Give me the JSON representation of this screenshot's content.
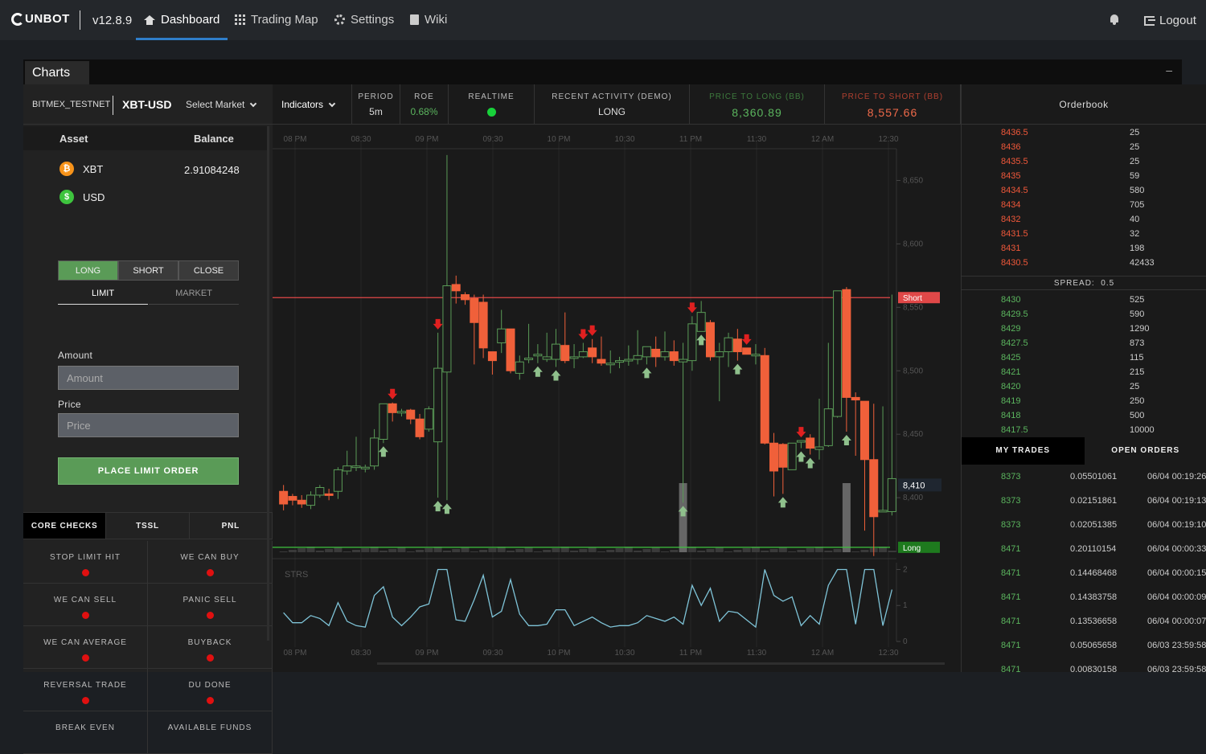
{
  "nav": {
    "brand": "UNBOT",
    "version": "v12.8.9",
    "items": [
      {
        "label": "Dashboard",
        "active": true
      },
      {
        "label": "Trading Map"
      },
      {
        "label": "Settings"
      },
      {
        "label": "Wiki"
      }
    ],
    "logout": "Logout"
  },
  "panel": {
    "title": "Charts",
    "minimize": "–"
  },
  "market": {
    "exchange": "BITMEX_TESTNET",
    "pair": "XBT-USD",
    "select_label": "Select Market"
  },
  "assets": {
    "header_asset": "Asset",
    "header_balance": "Balance",
    "rows": [
      {
        "symbol": "XBT",
        "balance": "2.91084248",
        "icon": "bitcoin-icon",
        "color": "#f7931a"
      },
      {
        "symbol": "USD",
        "balance": "",
        "icon": "dollar-icon",
        "color": "#3ec43e"
      }
    ]
  },
  "order": {
    "sides": [
      "LONG",
      "SHORT",
      "CLOSE"
    ],
    "types": [
      "LIMIT",
      "MARKET"
    ],
    "amount_label": "Amount",
    "amount_placeholder": "Amount",
    "price_label": "Price",
    "price_placeholder": "Price",
    "submit": "PLACE LIMIT ORDER"
  },
  "checks": {
    "tabs": [
      "CORE CHECKS",
      "TSSL",
      "PNL"
    ],
    "items": [
      "STOP LIMIT HIT",
      "WE CAN BUY",
      "WE CAN SELL",
      "PANIC SELL",
      "WE CAN AVERAGE",
      "BUYBACK",
      "REVERSAL TRADE",
      "DU DONE",
      "BREAK EVEN",
      "AVAILABLE FUNDS"
    ]
  },
  "infobar": {
    "indicators": "Indicators",
    "period_label": "PERIOD",
    "period": "5m",
    "roe_label": "ROE",
    "roe": "0.68%",
    "realtime_label": "REALTIME",
    "activity_label": "RECENT ACTIVITY (DEMO)",
    "activity": "LONG",
    "ptl_label": "PRICE TO LONG (BB)",
    "ptl": "8,360.89",
    "pts_label": "PRICE TO SHORT (BB)",
    "pts": "8,557.66"
  },
  "colors": {
    "up": "#5a9b57",
    "down": "#f0603a",
    "short_line": "#e04848",
    "long_line": "#3ec43e",
    "accent": "#2f7ec9"
  },
  "chart_data": {
    "type": "candlestick",
    "x_ticks": [
      "08 PM",
      "08:30",
      "09 PM",
      "09:30",
      "10 PM",
      "10:30",
      "11 PM",
      "11:30",
      "12 AM",
      "12:30"
    ],
    "y_ticks": [
      "8,650",
      "8,600",
      "8,550",
      "8,500",
      "8,450",
      "8,400"
    ],
    "ylim": [
      8357,
      8675
    ],
    "short_label": "Short",
    "short_level": 8557.66,
    "long_label": "Long",
    "long_level": 8360.89,
    "last_price": "8,410",
    "candles": [
      [
        8405,
        8395,
        8410,
        8390
      ],
      [
        8401,
        8398,
        8403,
        8394
      ],
      [
        8398,
        8395,
        8402,
        8392
      ],
      [
        8394,
        8402,
        8405,
        8391
      ],
      [
        8402,
        8408,
        8410,
        8400
      ],
      [
        8403,
        8402,
        8407,
        8398
      ],
      [
        8405,
        8422,
        8424,
        8399
      ],
      [
        8421,
        8425,
        8437,
        8418
      ],
      [
        8424,
        8425,
        8448,
        8421
      ],
      [
        8424,
        8424,
        8426,
        8420
      ],
      [
        8425,
        8447,
        8454,
        8422
      ],
      [
        8446,
        8474,
        8470,
        8443
      ],
      [
        8474,
        8467,
        8475,
        8460
      ],
      [
        8467,
        8468,
        8470,
        8464
      ],
      [
        8469,
        8462,
        8470,
        8458
      ],
      [
        8462,
        8448,
        8466,
        8446
      ],
      [
        8454,
        8470,
        8472,
        8452
      ],
      [
        8444,
        8502,
        8530,
        8400
      ],
      [
        8499,
        8567,
        8670,
        8398
      ],
      [
        8568,
        8563,
        8575,
        8553
      ],
      [
        8560,
        8556,
        8562,
        8552
      ],
      [
        8557,
        8538,
        8560,
        8505
      ],
      [
        8554,
        8518,
        8560,
        8510
      ],
      [
        8515,
        8508,
        8515,
        8497
      ],
      [
        8522,
        8533,
        8548,
        8514
      ],
      [
        8533,
        8500,
        8532,
        8498
      ],
      [
        8498,
        8507,
        8512,
        8493
      ],
      [
        8509,
        8510,
        8537,
        8506
      ],
      [
        8512,
        8513,
        8521,
        8506
      ],
      [
        8509,
        8511,
        8530,
        8507
      ],
      [
        8509,
        8521,
        8533,
        8503
      ],
      [
        8520,
        8508,
        8546,
        8506
      ],
      [
        8510,
        8511,
        8521,
        8502
      ],
      [
        8511,
        8515,
        8522,
        8510
      ],
      [
        8518,
        8511,
        8525,
        8506
      ],
      [
        8509,
        8506,
        8527,
        8504
      ],
      [
        8506,
        8506,
        8516,
        8498
      ],
      [
        8507,
        8508,
        8511,
        8502
      ],
      [
        8508,
        8509,
        8520,
        8504
      ],
      [
        8509,
        8512,
        8532,
        8505
      ],
      [
        8511,
        8519,
        8516,
        8505
      ],
      [
        8517,
        8511,
        8527,
        8503
      ],
      [
        8511,
        8515,
        8531,
        8508
      ],
      [
        8515,
        8508,
        8524,
        8504
      ],
      [
        8507,
        8509,
        8522,
        8396
      ],
      [
        8508,
        8537,
        8543,
        8500
      ],
      [
        8531,
        8546,
        8555,
        8537
      ],
      [
        8538,
        8511,
        8540,
        8508
      ],
      [
        8511,
        8515,
        8522,
        8476
      ],
      [
        8515,
        8526,
        8530,
        8503
      ],
      [
        8525,
        8515,
        8533,
        8508
      ],
      [
        8518,
        8513,
        8516,
        8513
      ],
      [
        8513,
        8513,
        8521,
        8505
      ],
      [
        8512,
        8443,
        8518,
        8442
      ],
      [
        8443,
        8421,
        8451,
        8401
      ],
      [
        8442,
        8424,
        8443,
        8403
      ],
      [
        8422,
        8443,
        8443,
        8422
      ],
      [
        8444,
        8445,
        8442,
        8439
      ],
      [
        8447,
        8439,
        8450,
        8434
      ],
      [
        8438,
        8440,
        8478,
        8430
      ],
      [
        8441,
        8470,
        8522,
        8440
      ],
      [
        8464,
        8563,
        8532,
        8463
      ],
      [
        8564,
        8479,
        8566,
        8452
      ],
      [
        8479,
        8477,
        8483,
        8433
      ],
      [
        8476,
        8430,
        8469,
        8374
      ],
      [
        8430,
        8385,
        8474,
        8354
      ],
      [
        8389,
        8390,
        8472,
        8390
      ],
      [
        8389,
        8415,
        8560,
        8386
      ]
    ],
    "buy_markers": [
      11,
      17,
      18,
      28,
      30,
      40,
      44,
      46,
      50,
      55,
      57,
      58,
      62
    ],
    "sell_markers": [
      12,
      17,
      33,
      34,
      45,
      51,
      57
    ],
    "volume_indices": [
      44,
      62
    ],
    "osc_label": "STRS",
    "osc_ticks": [
      "2",
      "1",
      "0"
    ],
    "osc_ylim": [
      0,
      2.1
    ]
  },
  "orderbook": {
    "title": "Orderbook",
    "asks": [
      [
        "8436.5",
        "25"
      ],
      [
        "8436",
        "25"
      ],
      [
        "8435.5",
        "25"
      ],
      [
        "8435",
        "59"
      ],
      [
        "8434.5",
        "580"
      ],
      [
        "8434",
        "705"
      ],
      [
        "8432",
        "40"
      ],
      [
        "8431.5",
        "32"
      ],
      [
        "8431",
        "198"
      ],
      [
        "8430.5",
        "42433"
      ]
    ],
    "spread_label": "SPREAD:",
    "spread": "0.5",
    "bids": [
      [
        "8430",
        "525"
      ],
      [
        "8429.5",
        "590"
      ],
      [
        "8429",
        "1290"
      ],
      [
        "8427.5",
        "873"
      ],
      [
        "8425",
        "115"
      ],
      [
        "8421",
        "215"
      ],
      [
        "8420",
        "25"
      ],
      [
        "8419",
        "250"
      ],
      [
        "8418",
        "500"
      ],
      [
        "8417.5",
        "10000"
      ]
    ]
  },
  "trades": {
    "tabs": [
      "MY TRADES",
      "OPEN ORDERS"
    ],
    "rows": [
      [
        "8373",
        "0.05501061",
        "06/04 00:19:26"
      ],
      [
        "8373",
        "0.02151861",
        "06/04 00:19:13"
      ],
      [
        "8373",
        "0.02051385",
        "06/04 00:19:10"
      ],
      [
        "8471",
        "0.20110154",
        "06/04 00:00:33"
      ],
      [
        "8471",
        "0.14468468",
        "06/04 00:00:15"
      ],
      [
        "8471",
        "0.14383758",
        "06/04 00:00:09"
      ],
      [
        "8471",
        "0.13536658",
        "06/04 00:00:07"
      ],
      [
        "8471",
        "0.05065658",
        "06/03 23:59:58"
      ],
      [
        "8471",
        "0.00830158",
        "06/03 23:59:58"
      ]
    ]
  }
}
